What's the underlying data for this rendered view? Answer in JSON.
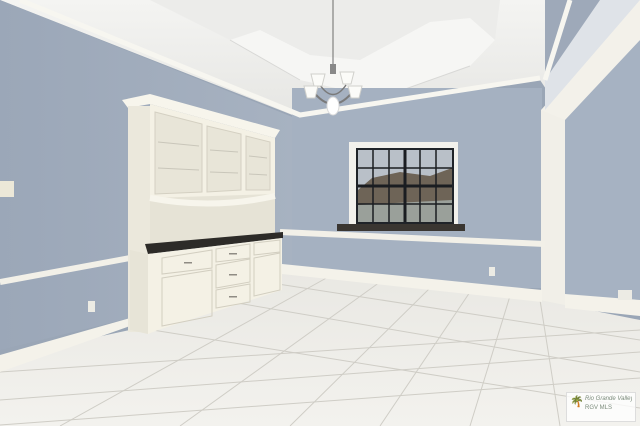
{
  "photo": {
    "subject": "Empty dining room",
    "colors": {
      "wall": "#a3afbf",
      "ceiling": "#f1f1ef",
      "trim": "#f4f2ea",
      "floor": "#ecebe6",
      "cabinet": "#f5f2e6",
      "countertop": "#2d2b28"
    },
    "icons": [
      "chandelier-icon",
      "window-icon",
      "palm-icon"
    ]
  },
  "watermark": {
    "brand": "Rio Grande Valley",
    "tag": "RGV MLS"
  }
}
